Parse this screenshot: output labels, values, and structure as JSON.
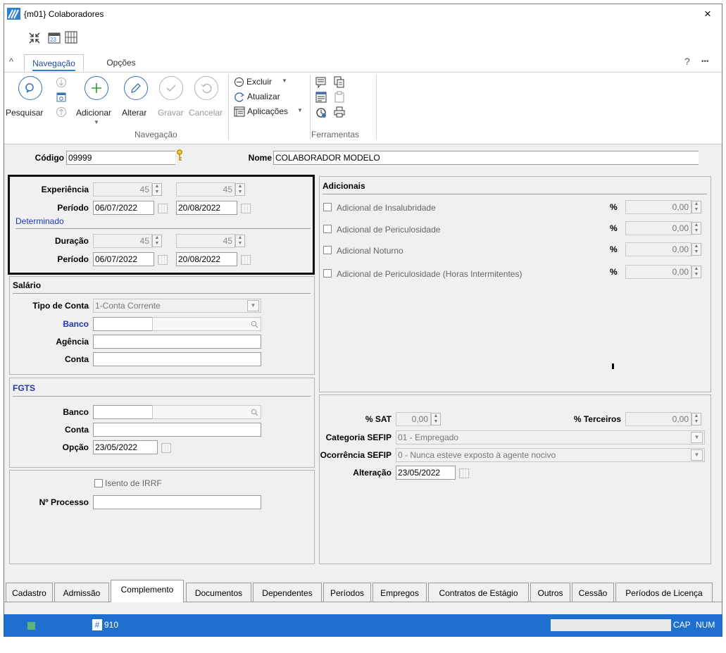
{
  "window": {
    "title": "{m01} Colaboradores",
    "close_glyph": "×"
  },
  "ribbon": {
    "collapse_glyph": "^",
    "tabs": [
      {
        "label": "Navegação"
      },
      {
        "label": "Opções"
      }
    ],
    "help_glyph": "?",
    "more_glyph": "•••",
    "buttons": {
      "pesquisar": "Pesquisar",
      "adicionar": "Adicionar",
      "alterar": "Alterar",
      "gravar": "Gravar",
      "cancelar": "Cancelar",
      "excluir": "Excluir",
      "atualizar": "Atualizar",
      "aplicacoes": "Aplicações"
    },
    "groups": {
      "navegacao": "Navegação",
      "ferramentas": "Ferramentas"
    }
  },
  "header": {
    "codigo_label": "Código",
    "codigo_value": "09999",
    "nome_label": "Nome",
    "nome_value": "COLABORADOR MODELO"
  },
  "experiencia": {
    "experiencia_label": "Experiência",
    "exp_value_1": "45",
    "exp_value_2": "45",
    "periodo_label": "Período",
    "periodo_start": "06/07/2022",
    "periodo_end": "20/08/2022",
    "determinado_label": "Determinado",
    "duracao_label": "Duração",
    "dur_value_1": "45",
    "dur_value_2": "45",
    "periodo2_label": "Período",
    "periodo2_start": "06/07/2022",
    "periodo2_end": "20/08/2022"
  },
  "salario": {
    "title": "Salário",
    "tipo_conta_label": "Tipo de Conta",
    "tipo_conta_value": "1-Conta Corrente",
    "banco_label": "Banco",
    "agencia_label": "Agência",
    "conta_label": "Conta"
  },
  "fgts": {
    "title": "FGTS",
    "banco_label": "Banco",
    "conta_label": "Conta",
    "opcao_label": "Opção",
    "opcao_value": "23/05/2022"
  },
  "irrf": {
    "isento_label": "Isento de IRRF",
    "processo_label": "Nº Processo"
  },
  "adicionais": {
    "title": "Adicionais",
    "percent_label": "%",
    "items": [
      {
        "label": "Adicional de Insalubridade",
        "value": "0,00"
      },
      {
        "label": "Adicional de Periculosidade",
        "value": "0,00"
      },
      {
        "label": "Adicional Noturno",
        "value": "0,00"
      },
      {
        "label": "Adicional de Periculosidade (Horas Intermitentes)",
        "value": "0,00"
      }
    ]
  },
  "sefip": {
    "sat_label": "% SAT",
    "sat_value": "0,00",
    "terceiros_label": "% Terceiros",
    "terceiros_value": "0,00",
    "categoria_label": "Categoria SEFIP",
    "categoria_value": "01 - Empregado",
    "ocorrencia_label": "Ocorrência SEFIP",
    "ocorrencia_value": "0 - Nunca esteve exposto à agente nocivo",
    "alteracao_label": "Alteração",
    "alteracao_value": "23/05/2022"
  },
  "bottom_tabs": [
    {
      "label": "Cadastro"
    },
    {
      "label": "Admissão"
    },
    {
      "label": "Complemento"
    },
    {
      "label": "Documentos"
    },
    {
      "label": "Dependentes"
    },
    {
      "label": "Períodos"
    },
    {
      "label": "Empregos"
    },
    {
      "label": "Contratos de Estágio"
    },
    {
      "label": "Outros"
    },
    {
      "label": "Cessão"
    },
    {
      "label": "Períodos de Licença"
    }
  ],
  "status": {
    "hash_glyph": "#",
    "record_number": "910",
    "cap": "CAP",
    "num": "NUM"
  },
  "colors": {
    "accent": "#1f6fce",
    "label_blue": "#1c39b0",
    "icon_blue": "#3d6fb3"
  }
}
